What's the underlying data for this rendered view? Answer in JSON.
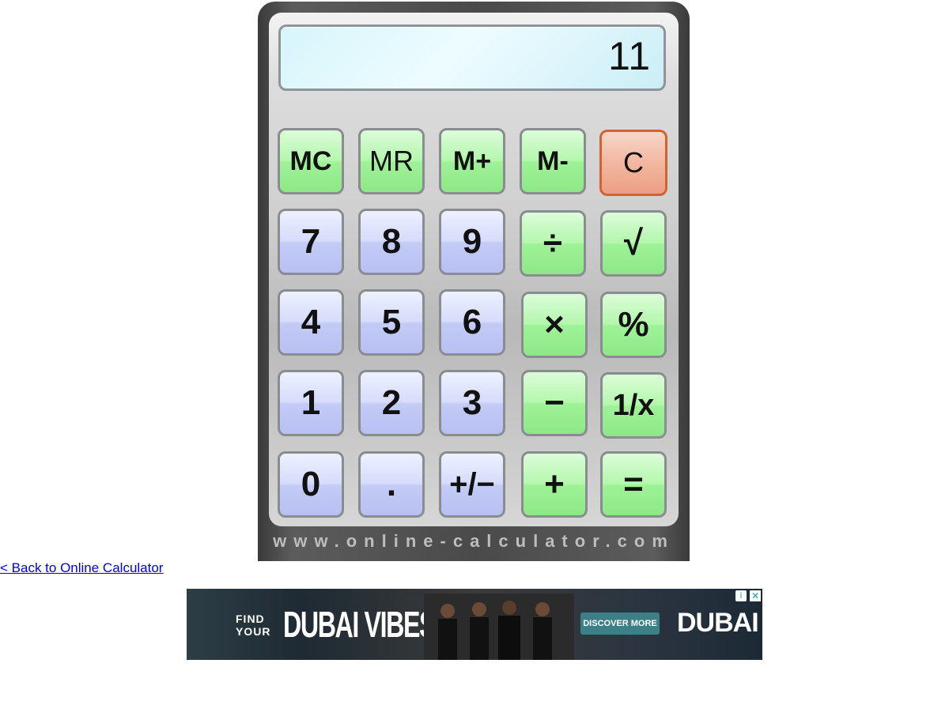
{
  "display": {
    "value": "11"
  },
  "keys": {
    "mc": "MC",
    "mr": "MR",
    "m_plus": "M+",
    "m_minus": "M-",
    "clear": "C",
    "seven": "7",
    "eight": "8",
    "nine": "9",
    "divide": "÷",
    "sqrt": "√",
    "four": "4",
    "five": "5",
    "six": "6",
    "multiply": "×",
    "percent": "%",
    "one": "1",
    "two": "2",
    "three": "3",
    "minus": "−",
    "reciprocal": "1/x",
    "zero": "0",
    "dot": ".",
    "plus_minus": "+/−",
    "plus": "+",
    "equals": "="
  },
  "footer": {
    "site": "www.online-calculator.com"
  },
  "link": {
    "back": "< Back to Online Calculator"
  },
  "ad": {
    "find": "FIND",
    "your": "YOUR",
    "headline": "DUBAI VIBES",
    "cta": "DISCOVER MORE",
    "brand": "DUBAI",
    "info_icon": "info-icon",
    "close_icon": "close-icon"
  },
  "colors": {
    "green_key": "#9ef297",
    "blue_key": "#c3cbf6",
    "clear_key": "#f2b7a0",
    "display_bg": "#e8fbff",
    "case": "#4a4a4a"
  }
}
